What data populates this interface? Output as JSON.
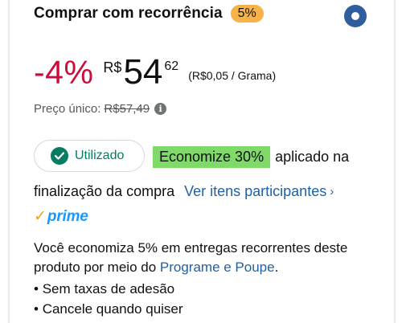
{
  "header": {
    "title": "Comprar com recorrência",
    "discount_badge": "5%"
  },
  "price": {
    "discount": "-4%",
    "currency": "R$",
    "whole": "54",
    "fraction": "62",
    "unit_price": "(R$0,05 / Grama)"
  },
  "single": {
    "label": "Preço único:",
    "price": "R$57,49",
    "info_icon": "info-icon"
  },
  "coupon": {
    "used_label": "Utilizado",
    "save_label": "Economize 30%",
    "applied_text": "aplicado na",
    "checkout_text": "finalização da compra",
    "link_text": "Ver itens participantes",
    "chevron": "›"
  },
  "prime": {
    "check": "✓",
    "word": "prime"
  },
  "description": {
    "prefix": "Você economiza 5% em entregas recorrentes deste produto por meio do ",
    "link": "Programe e Poupe",
    "suffix": "."
  },
  "bullets": [
    "Sem taxas de adesão",
    "Cancele quando quiser"
  ],
  "colors": {
    "accent_red": "#cc0c39",
    "badge_orange": "#f7b347",
    "selected_radio": "#2f5d9e",
    "success_green": "#067d62",
    "save_highlight": "#7fda69",
    "link_blue": "#2162a1",
    "prime_blue": "#1a98ff"
  }
}
